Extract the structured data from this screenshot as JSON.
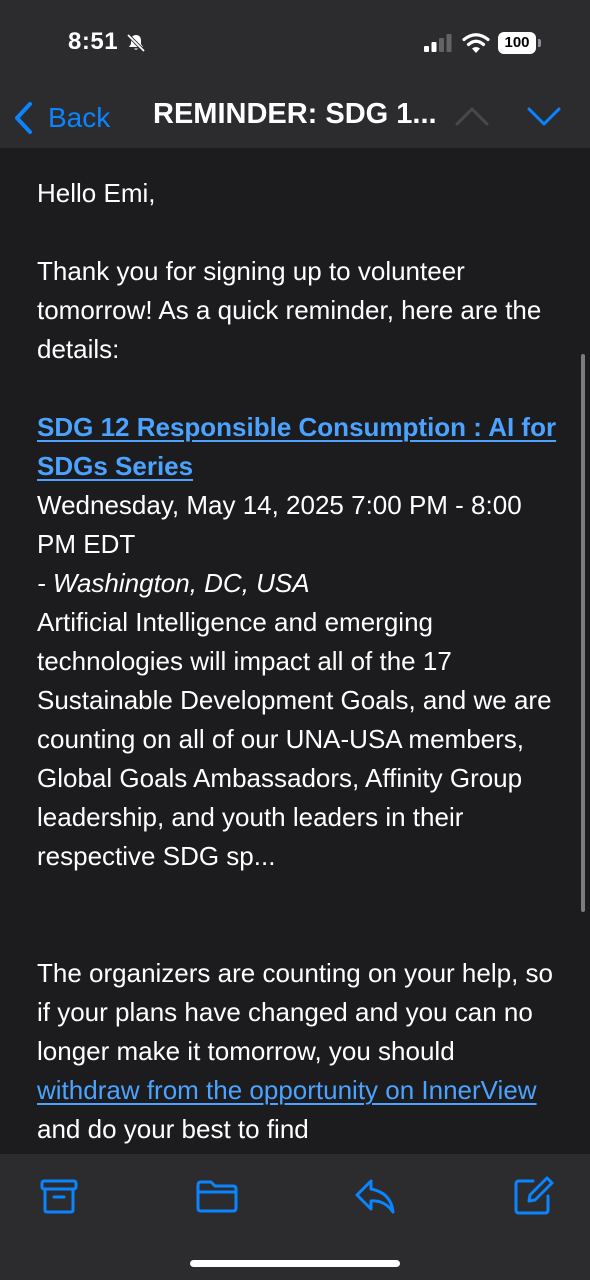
{
  "status_bar": {
    "time": "8:51",
    "battery": "100"
  },
  "nav": {
    "back_label": "Back",
    "title": "REMINDER: SDG 1..."
  },
  "email": {
    "greeting": "Hello Emi,",
    "intro": "Thank you for signing up to volunteer tomorrow! As a quick reminder, here are the details:",
    "event_title": "SDG 12 Responsible Consumption : AI for SDGs Series",
    "event_datetime": "Wednesday, May 14, 2025 7:00 PM - 8:00 PM EDT",
    "event_location": "- Washington, DC, USA",
    "event_description": "Artificial Intelligence and emerging technologies will impact all of the 17 Sustainable Development Goals, and we are counting on all of our UNA-USA members, Global Goals Ambassadors, Affinity Group leadership, and youth leaders in their respective SDG sp...",
    "closing_before_link": "The organizers are counting on your help, so if your plans have changed and you can no longer make it tomorrow, you should ",
    "withdraw_link": "withdraw from the opportunity on InnerView",
    "closing_after_link": " and do your best to find"
  },
  "toolbar": {
    "archive_icon": "archive-icon",
    "folder_icon": "folder-icon",
    "reply_icon": "reply-icon",
    "compose_icon": "compose-icon"
  },
  "colors": {
    "accent": "#0a84ff",
    "link": "#4ba3ff",
    "background": "#1c1c1e",
    "bar_background": "#2c2c2e"
  }
}
